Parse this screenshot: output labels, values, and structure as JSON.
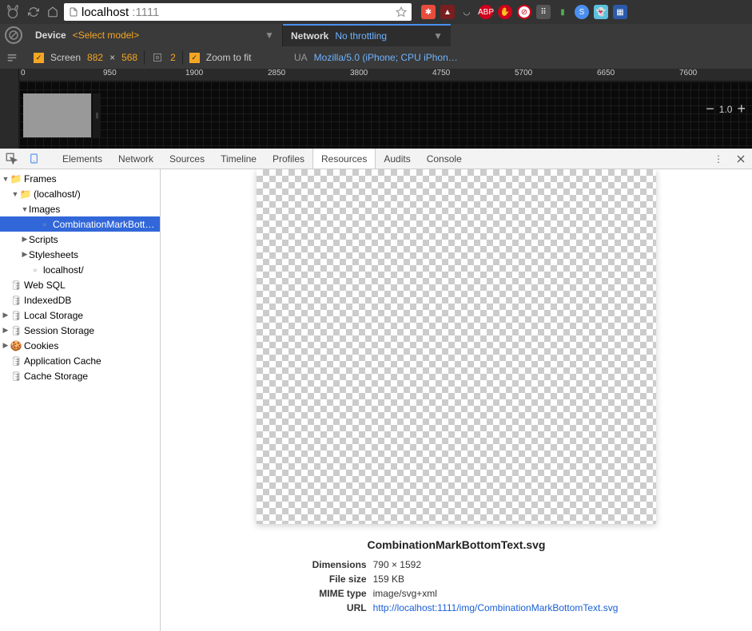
{
  "url": {
    "host": "localhost",
    "port": ":1111"
  },
  "device_bar": {
    "device_label": "Device",
    "select_model": "<Select model>",
    "screen_label": "Screen",
    "width": "882",
    "height": "568",
    "times": "×",
    "dpr": "2",
    "zoom_fit": "Zoom to fit",
    "network_label": "Network",
    "throttling": "No throttling",
    "ua_label": "UA",
    "ua_value": "Mozilla/5.0 (iPhone; CPU iPhon…"
  },
  "ruler": {
    "ticks": [
      "0",
      "950",
      "1900",
      "2850",
      "3800",
      "4750",
      "5700",
      "6650",
      "7600"
    ],
    "zoom": "1.0"
  },
  "tabs": [
    "Elements",
    "Network",
    "Sources",
    "Timeline",
    "Profiles",
    "Resources",
    "Audits",
    "Console"
  ],
  "active_tab": "Resources",
  "sidebar": {
    "frames": "Frames",
    "localhost": "(localhost/)",
    "images": "Images",
    "selected_file": "CombinationMarkBott…",
    "scripts": "Scripts",
    "stylesheets": "Stylesheets",
    "localhost_file": "localhost/",
    "websql": "Web SQL",
    "indexeddb": "IndexedDB",
    "localstorage": "Local Storage",
    "sessionstorage": "Session Storage",
    "cookies": "Cookies",
    "appcache": "Application Cache",
    "cachestorage": "Cache Storage"
  },
  "preview": {
    "filename": "CombinationMarkBottomText.svg",
    "dim_label": "Dimensions",
    "dim_value": "790 × 1592",
    "size_label": "File size",
    "size_value": "159 KB",
    "mime_label": "MIME type",
    "mime_value": "image/svg+xml",
    "url_label": "URL",
    "url_value": "http://localhost:1111/img/CombinationMarkBottomText.svg"
  }
}
